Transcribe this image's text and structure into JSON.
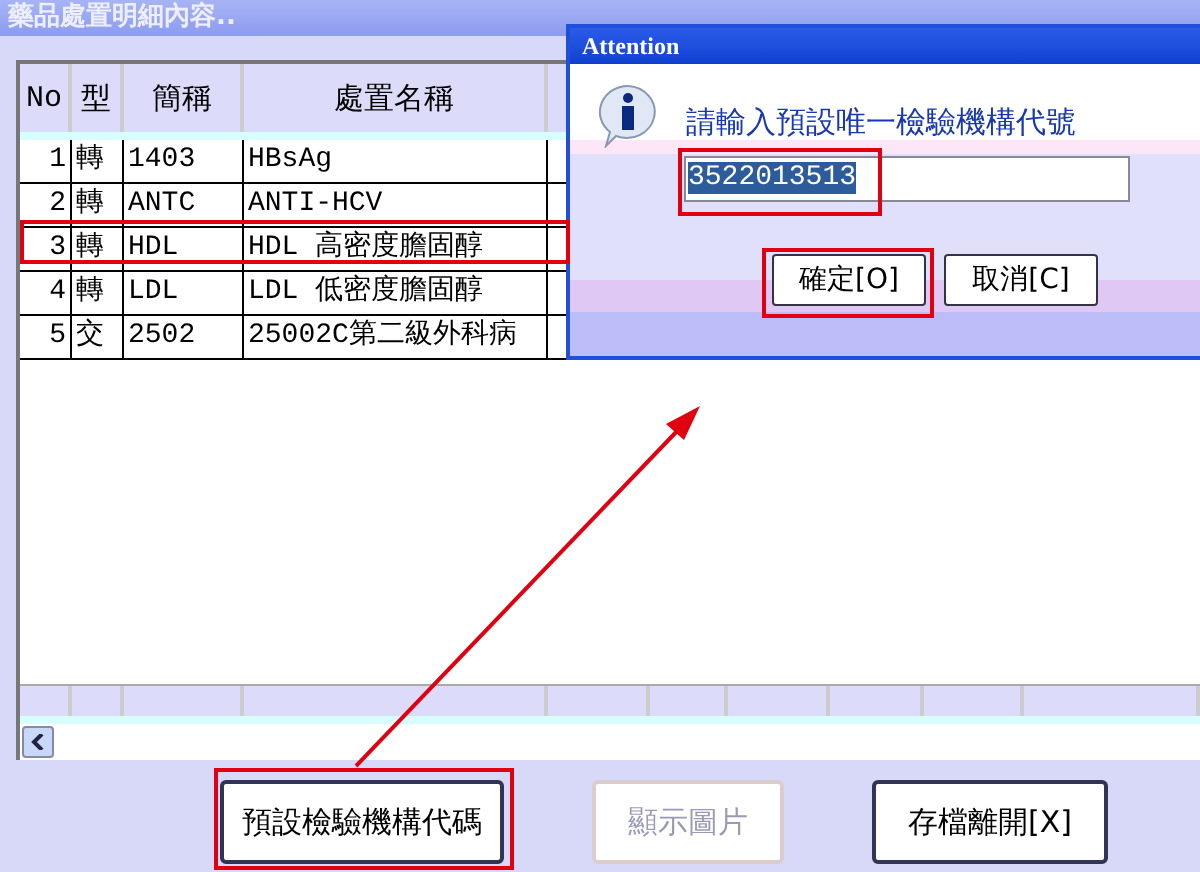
{
  "window": {
    "title": "藥品處置明細內容.."
  },
  "table": {
    "columns": [
      "No",
      "型",
      "簡稱",
      "處置名稱"
    ],
    "rows": [
      {
        "no": "1",
        "type": "轉",
        "code": "1403",
        "name": "HBsAg"
      },
      {
        "no": "2",
        "type": "轉",
        "code": "ANTC",
        "name": "ANTI-HCV"
      },
      {
        "no": "3",
        "type": "轉",
        "code": "HDL",
        "name": "HDL  高密度膽固醇"
      },
      {
        "no": "4",
        "type": "轉",
        "code": "LDL",
        "name": "LDL  低密度膽固醇"
      },
      {
        "no": "5",
        "type": "交",
        "code": "2502",
        "name": "25002C第二級外科病"
      }
    ]
  },
  "buttons": [
    {
      "label": "預設檢驗機構代碼",
      "disabled": false
    },
    {
      "label": "顯示圖片",
      "disabled": true
    },
    {
      "label": "存檔離開[X]",
      "disabled": false
    }
  ],
  "dialog": {
    "title": "Attention",
    "message": "請輸入預設唯一檢驗機構代號",
    "value": "3522013513",
    "buttons": [
      "確定[O]",
      "取消[C]"
    ]
  }
}
